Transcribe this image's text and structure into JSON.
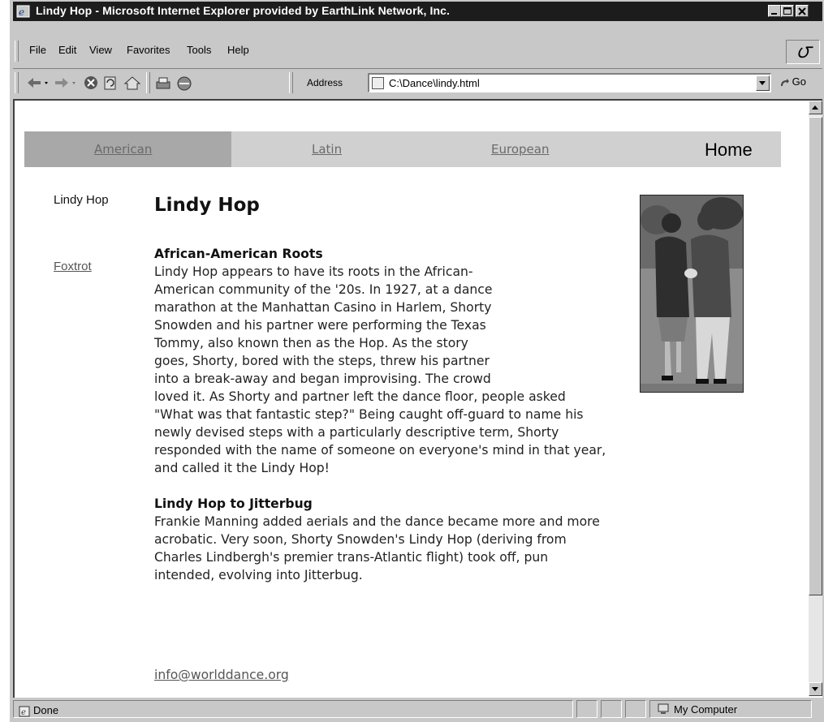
{
  "window": {
    "title": "Lindy Hop - Microsoft Internet Explorer provided by EarthLink Network, Inc."
  },
  "menu": {
    "file": "File",
    "edit": "Edit",
    "view": "View",
    "favorites": "Favorites",
    "tools": "Tools",
    "help": "Help"
  },
  "toolbar": {
    "address_label": "Address",
    "address_value": "C:\\Dance\\lindy.html",
    "go_label": "Go",
    "icons": [
      "back-icon",
      "forward-icon",
      "stop-icon",
      "refresh-icon",
      "home-icon",
      "print-icon",
      "mail-icon"
    ]
  },
  "nav": {
    "american": "American",
    "latin": "Latin",
    "european": "European",
    "home": "Home"
  },
  "sidebar": {
    "current": "Lindy Hop",
    "foxtrot": "Foxtrot"
  },
  "article": {
    "title": "Lindy Hop",
    "section1_heading": "African-American Roots",
    "section1_lines": [
      "Lindy Hop appears to have its roots in the African-",
      "American community of the '20s. In 1927, at a dance",
      "marathon at the Manhattan Casino in Harlem, Shorty",
      "Snowden and his partner were performing the Texas",
      "Tommy, also known then as the Hop. As the story",
      "goes, Shorty, bored with the steps, threw his partner",
      "into a break-away and began improvising. The crowd",
      "loved it. As Shorty and partner left the dance floor, people asked",
      "\"What was that fantastic step?\" Being caught off-guard to name his",
      "newly devised steps with a particularly descriptive term, Shorty",
      "responded with the name of someone on everyone's mind in that year,",
      "and called it the Lindy Hop!"
    ],
    "section2_heading": "Lindy Hop to Jitterbug",
    "section2_lines": [
      "Frankie Manning added aerials and the dance became more and more",
      "acrobatic. Very soon, Shorty Snowden's Lindy Hop (deriving from",
      "Charles Lindbergh's premier trans-Atlantic flight) took off, pun",
      "intended, evolving into Jitterbug."
    ],
    "email": "info@worlddance.org"
  },
  "status": {
    "text": "Done",
    "zone": "My Computer"
  }
}
